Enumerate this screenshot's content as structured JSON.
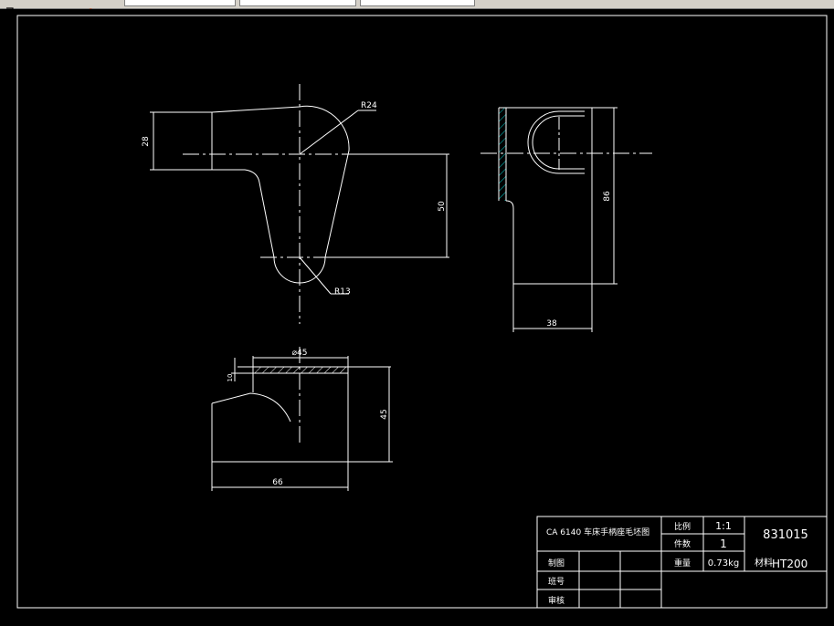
{
  "window": {
    "toolbar": {
      "buttons": [
        "arrow-icon",
        "redo-icon"
      ],
      "fields": [
        "",
        "",
        ""
      ]
    }
  },
  "drawing": {
    "front_view": {
      "dims": {
        "height_left": "28",
        "radius_top": "R24",
        "height_right": "50",
        "radius_bottom": "R13"
      }
    },
    "side_view": {
      "dims": {
        "height": "86",
        "width": "38"
      }
    },
    "top_view": {
      "dims": {
        "diameter": "⌀45",
        "small": "10",
        "height": "45",
        "width": "66"
      }
    }
  },
  "title_block": {
    "drawing_name": "CA 6140 车床手柄座毛坯图",
    "scale_label": "比例",
    "scale_value": "1:1",
    "qty_label": "件数",
    "qty_value": "1",
    "weight_label": "重量",
    "weight_value": "0.73kg",
    "material_label": "材料",
    "material_value": "HT200",
    "drawing_number": "831015",
    "drawn_label": "制图",
    "class_label": "班号",
    "review_label": "审核"
  },
  "colors": {
    "background": "#000000",
    "lines": "#ffffff",
    "hatch": "#00b0b0",
    "toolbar": "#d4d0c8"
  }
}
